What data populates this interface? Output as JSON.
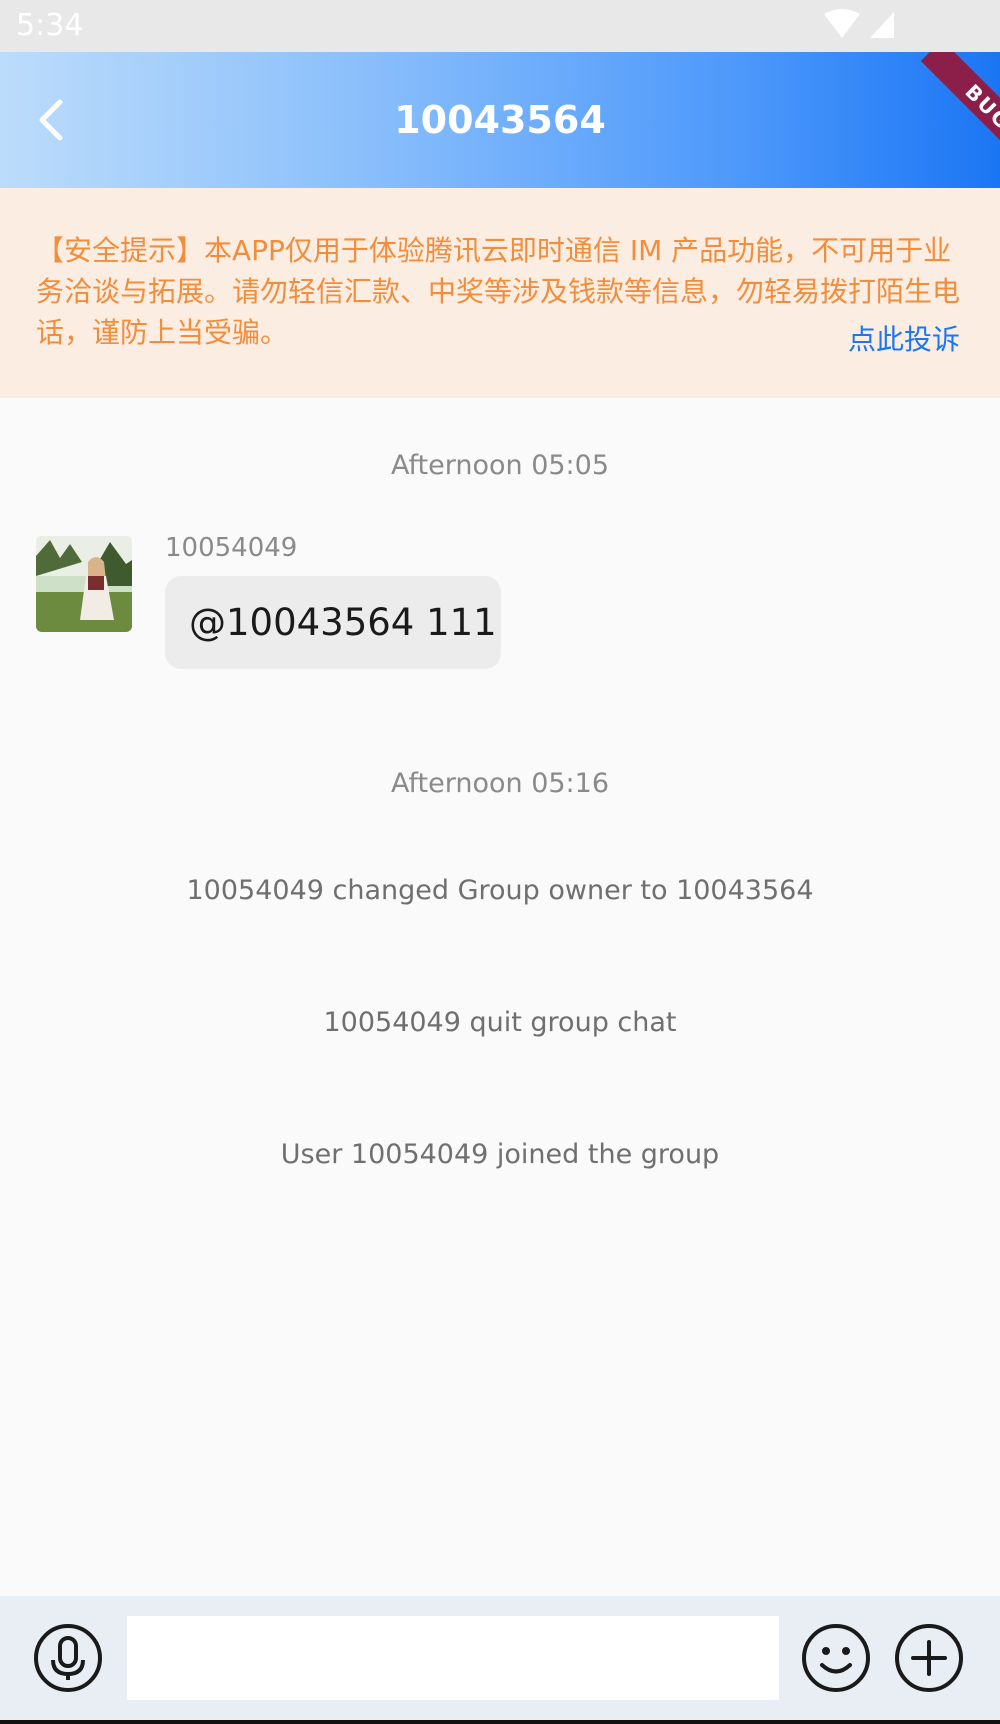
{
  "status_bar": {
    "time": "5:34"
  },
  "app_bar": {
    "title": "10043564",
    "debug_badge": "BUG"
  },
  "notice": {
    "text": "【安全提示】本APP仅用于体验腾讯云即时通信 IM 产品功能，不可用于业务洽谈与拓展。请勿轻信汇款、中奖等涉及钱款等信息，勿轻易拨打陌生电话，谨防上当受骗。",
    "link": "点此投诉"
  },
  "messages": {
    "time_1": "Afternoon 05:05",
    "chat_1": {
      "sender": "10054049",
      "text": "@10043564 111"
    },
    "time_2": "Afternoon 05:16",
    "system_1": "10054049 changed Group owner to  10043564",
    "system_2": "10054049 quit group chat",
    "system_3": "User 10054049 joined the group"
  },
  "input_bar": {
    "placeholder": ""
  },
  "colors": {
    "notice_text": "#f28d3c",
    "notice_bg": "#fbede1",
    "link": "#1b76f4",
    "appbar_start": "#bcdcfb",
    "appbar_end": "#1b76f4"
  }
}
